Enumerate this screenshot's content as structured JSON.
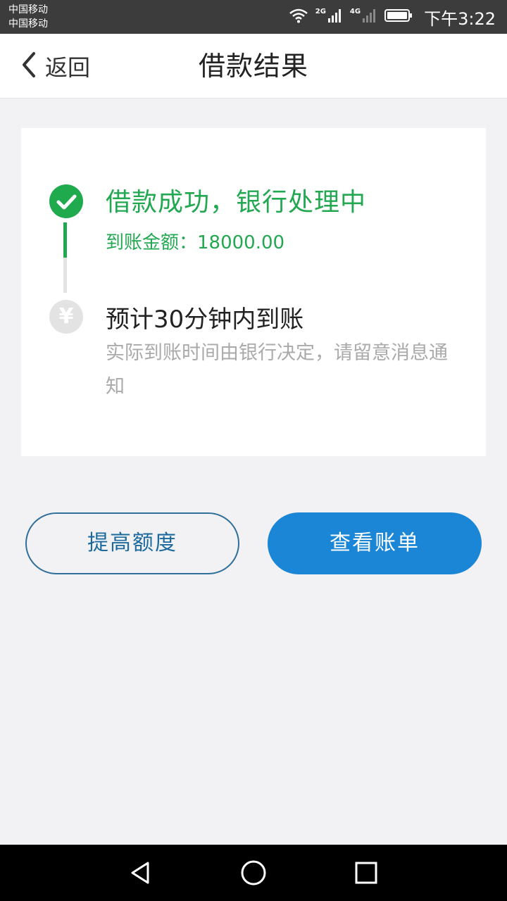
{
  "status_bar": {
    "carriers": [
      "中国移动",
      "中国移动"
    ],
    "network_tags": [
      "2G",
      "4G"
    ],
    "time": "下午3:22"
  },
  "nav": {
    "back_label": "返回",
    "title": "借款结果"
  },
  "steps": {
    "success_title": "借款成功，银行处理中",
    "amount_text": "到账金额：18000.00",
    "pending_symbol": "¥",
    "pending_title": "预计30分钟内到账",
    "pending_desc": "实际到账时间由银行决定，请留意消息通知"
  },
  "actions": {
    "raise_limit_label": "提高额度",
    "view_bill_label": "查看账单"
  },
  "colors": {
    "success": "#23a852",
    "primary": "#1b86d5",
    "outline": "#2f6f99"
  },
  "icons": [
    "wifi-icon",
    "signal-icon",
    "battery-icon",
    "back-chevron-icon",
    "checkmark-icon",
    "yen-icon",
    "back-triangle-icon",
    "home-circle-icon",
    "recents-square-icon"
  ]
}
